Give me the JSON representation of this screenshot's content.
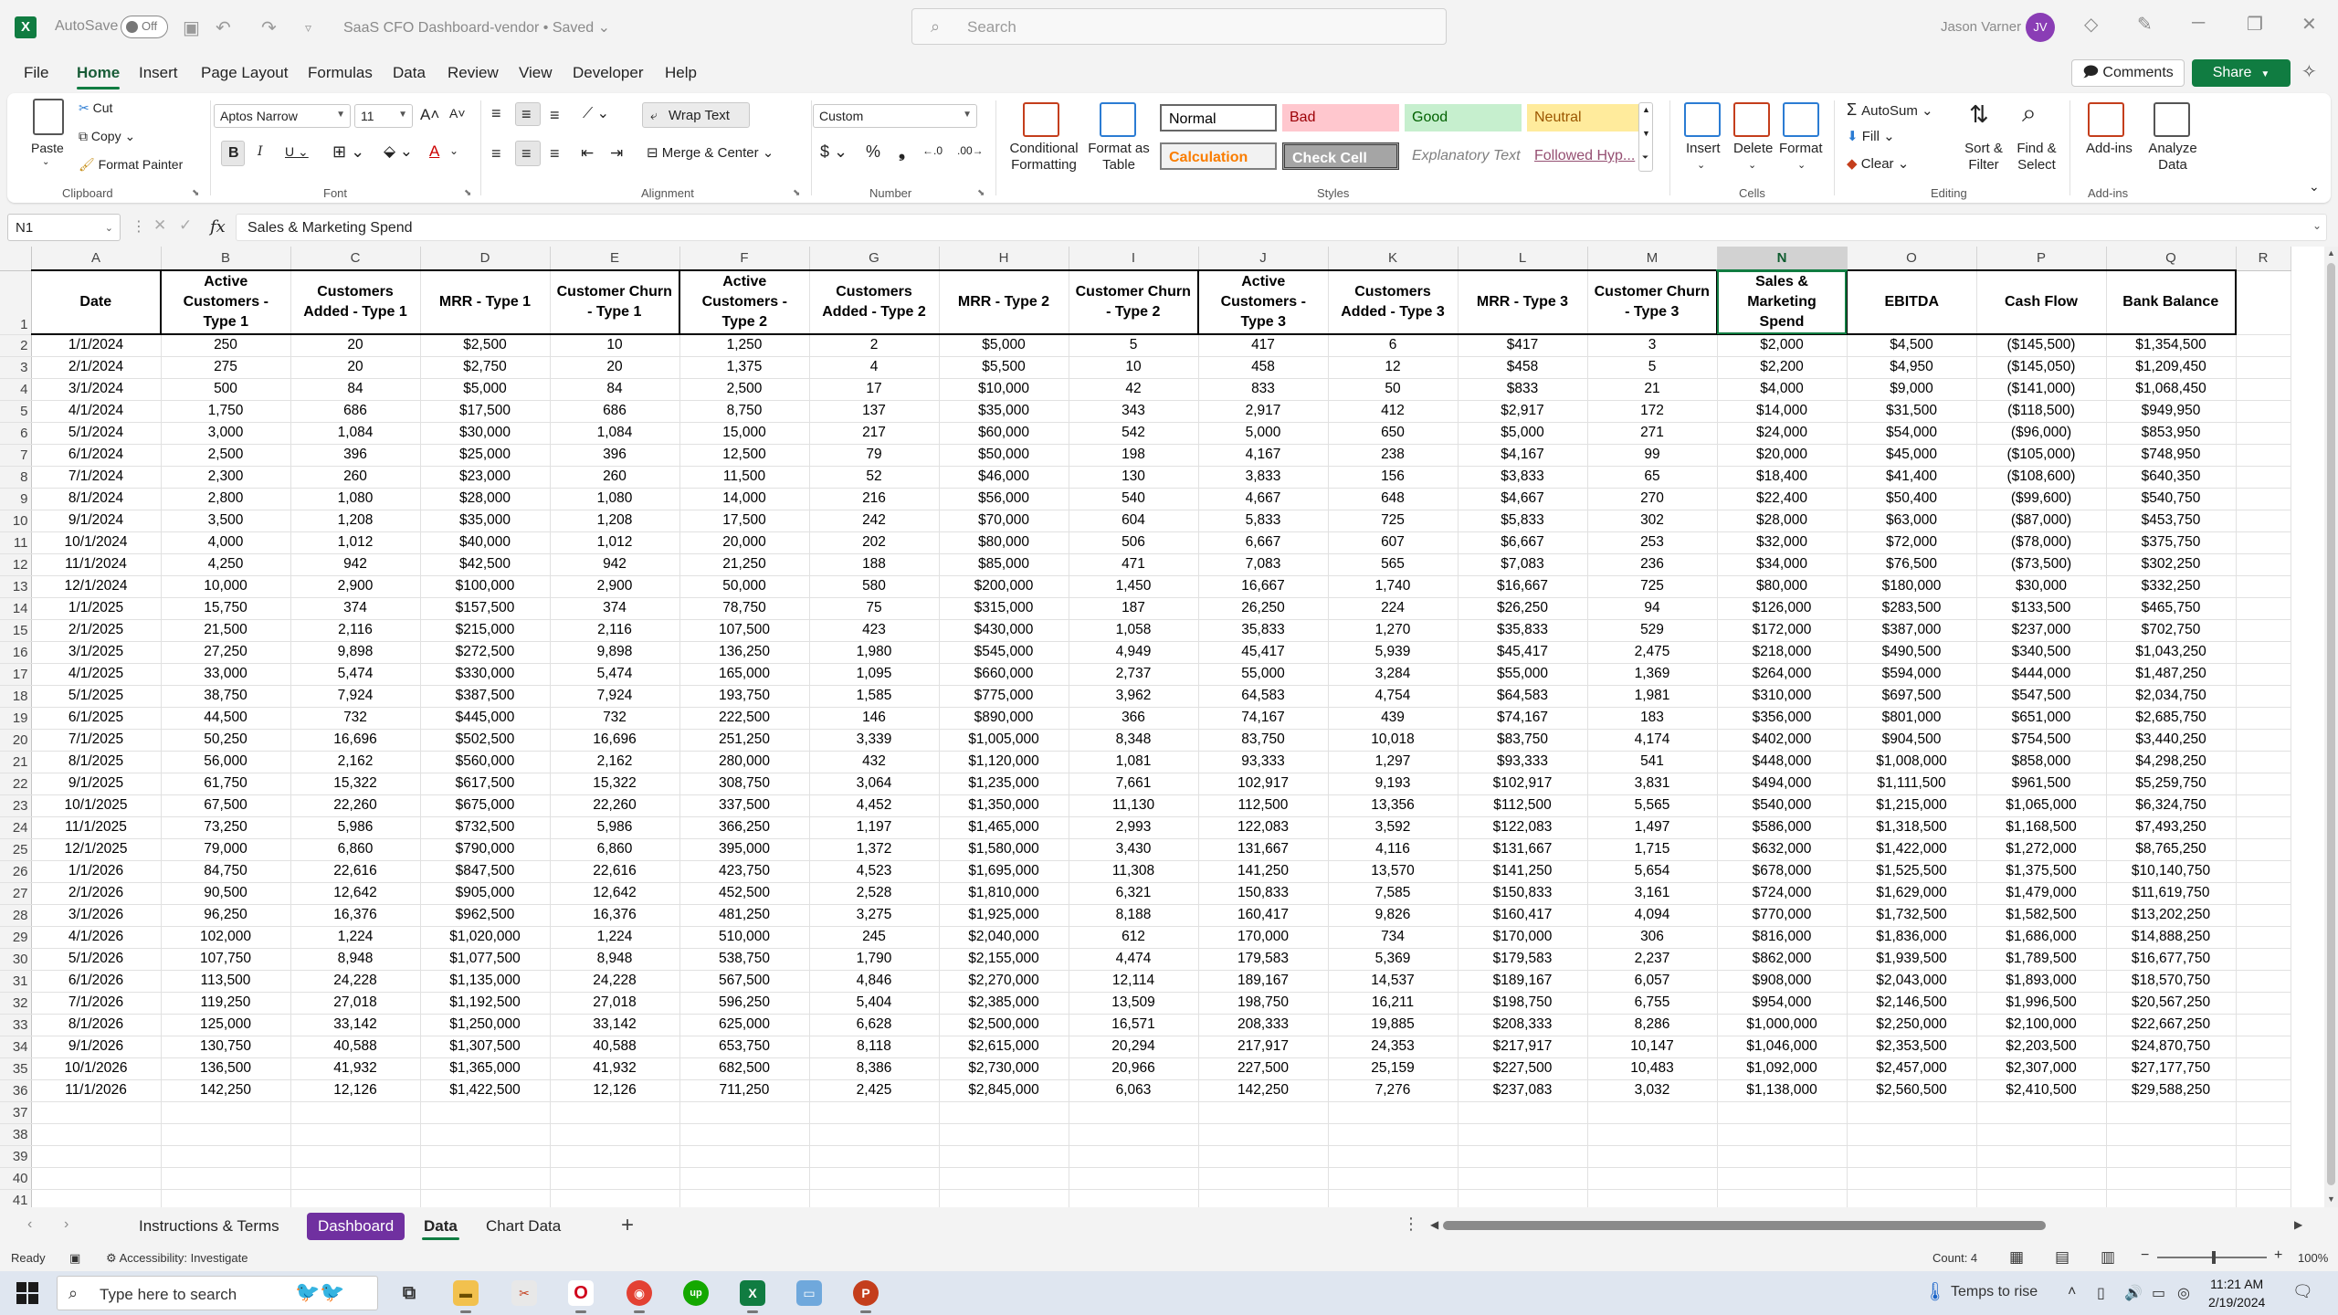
{
  "titlebar": {
    "autosave_label": "AutoSave",
    "autosave_state": "Off",
    "doc_title": "SaaS CFO Dashboard-vendor • Saved ⌄",
    "search_placeholder": "Search",
    "user_name": "Jason Varner",
    "user_initials": "JV"
  },
  "menu": {
    "tabs": [
      "File",
      "Home",
      "Insert",
      "Page Layout",
      "Formulas",
      "Data",
      "Review",
      "View",
      "Developer",
      "Help"
    ],
    "active": "Home",
    "comments_label": "Comments",
    "share_label": "Share"
  },
  "ribbon": {
    "clipboard": {
      "paste": "Paste",
      "cut": "Cut",
      "copy": "Copy",
      "format_painter": "Format Painter",
      "label": "Clipboard"
    },
    "font": {
      "name": "Aptos Narrow",
      "size": "11",
      "label": "Font"
    },
    "alignment": {
      "wrap_text": "Wrap Text",
      "merge_center": "Merge & Center",
      "label": "Alignment"
    },
    "number": {
      "format": "Custom",
      "label": "Number"
    },
    "styles": {
      "conditional_formatting": "Conditional Formatting",
      "format_as_table": "Format as Table",
      "label": "Styles",
      "cells": [
        {
          "label": "Normal",
          "bg": "#ffffff",
          "fg": "#000000"
        },
        {
          "label": "Bad",
          "bg": "#ffc7ce",
          "fg": "#9c0006"
        },
        {
          "label": "Good",
          "bg": "#c6efce",
          "fg": "#006100"
        },
        {
          "label": "Neutral",
          "bg": "#ffeb9c",
          "fg": "#9c5700"
        },
        {
          "label": "Calculation",
          "bg": "#f2f2f2",
          "fg": "#fa7d00"
        },
        {
          "label": "Check Cell",
          "bg": "#a5a5a5",
          "fg": "#ffffff"
        },
        {
          "label": "Explanatory Text",
          "bg": "#ffffff",
          "fg": "#7f7f7f"
        },
        {
          "label": "Followed Hyp...",
          "bg": "#ffffff",
          "fg": "#954f72"
        }
      ]
    },
    "cells": {
      "insert": "Insert",
      "delete": "Delete",
      "format": "Format",
      "label": "Cells"
    },
    "editing": {
      "autosum": "AutoSum",
      "fill": "Fill",
      "clear": "Clear",
      "sort_filter": "Sort & Filter",
      "find_select": "Find & Select",
      "label": "Editing"
    },
    "addins": {
      "addins": "Add-ins",
      "analyze": "Analyze Data",
      "label": "Add-ins"
    }
  },
  "formula_bar": {
    "name_box": "N1",
    "content": "Sales & Marketing Spend"
  },
  "sheet": {
    "columns": [
      "A",
      "B",
      "C",
      "D",
      "E",
      "F",
      "G",
      "H",
      "I",
      "J",
      "K",
      "L",
      "M",
      "N",
      "O",
      "P",
      "Q",
      "R"
    ],
    "selected_column": "N",
    "headers": [
      "Date",
      "Active Customers - Type 1",
      "Customers Added - Type 1",
      "MRR - Type 1",
      "Customer Churn - Type 1",
      "Active Customers - Type 2",
      "Customers Added - Type 2",
      "MRR - Type 2",
      "Customer Churn - Type 2",
      "Active Customers - Type 3",
      "Customers Added - Type 3",
      "MRR - Type 3",
      "Customer Churn - Type 3",
      "Sales & Marketing Spend",
      "EBITDA",
      "Cash Flow",
      "Bank Balance"
    ],
    "rows": [
      [
        "1/1/2024",
        "250",
        "20",
        "$2,500",
        "10",
        "1,250",
        "2",
        "$5,000",
        "5",
        "417",
        "6",
        "$417",
        "3",
        "$2,000",
        "$4,500",
        "($145,500)",
        "$1,354,500"
      ],
      [
        "2/1/2024",
        "275",
        "20",
        "$2,750",
        "20",
        "1,375",
        "4",
        "$5,500",
        "10",
        "458",
        "12",
        "$458",
        "5",
        "$2,200",
        "$4,950",
        "($145,050)",
        "$1,209,450"
      ],
      [
        "3/1/2024",
        "500",
        "84",
        "$5,000",
        "84",
        "2,500",
        "17",
        "$10,000",
        "42",
        "833",
        "50",
        "$833",
        "21",
        "$4,000",
        "$9,000",
        "($141,000)",
        "$1,068,450"
      ],
      [
        "4/1/2024",
        "1,750",
        "686",
        "$17,500",
        "686",
        "8,750",
        "137",
        "$35,000",
        "343",
        "2,917",
        "412",
        "$2,917",
        "172",
        "$14,000",
        "$31,500",
        "($118,500)",
        "$949,950"
      ],
      [
        "5/1/2024",
        "3,000",
        "1,084",
        "$30,000",
        "1,084",
        "15,000",
        "217",
        "$60,000",
        "542",
        "5,000",
        "650",
        "$5,000",
        "271",
        "$24,000",
        "$54,000",
        "($96,000)",
        "$853,950"
      ],
      [
        "6/1/2024",
        "2,500",
        "396",
        "$25,000",
        "396",
        "12,500",
        "79",
        "$50,000",
        "198",
        "4,167",
        "238",
        "$4,167",
        "99",
        "$20,000",
        "$45,000",
        "($105,000)",
        "$748,950"
      ],
      [
        "7/1/2024",
        "2,300",
        "260",
        "$23,000",
        "260",
        "11,500",
        "52",
        "$46,000",
        "130",
        "3,833",
        "156",
        "$3,833",
        "65",
        "$18,400",
        "$41,400",
        "($108,600)",
        "$640,350"
      ],
      [
        "8/1/2024",
        "2,800",
        "1,080",
        "$28,000",
        "1,080",
        "14,000",
        "216",
        "$56,000",
        "540",
        "4,667",
        "648",
        "$4,667",
        "270",
        "$22,400",
        "$50,400",
        "($99,600)",
        "$540,750"
      ],
      [
        "9/1/2024",
        "3,500",
        "1,208",
        "$35,000",
        "1,208",
        "17,500",
        "242",
        "$70,000",
        "604",
        "5,833",
        "725",
        "$5,833",
        "302",
        "$28,000",
        "$63,000",
        "($87,000)",
        "$453,750"
      ],
      [
        "10/1/2024",
        "4,000",
        "1,012",
        "$40,000",
        "1,012",
        "20,000",
        "202",
        "$80,000",
        "506",
        "6,667",
        "607",
        "$6,667",
        "253",
        "$32,000",
        "$72,000",
        "($78,000)",
        "$375,750"
      ],
      [
        "11/1/2024",
        "4,250",
        "942",
        "$42,500",
        "942",
        "21,250",
        "188",
        "$85,000",
        "471",
        "7,083",
        "565",
        "$7,083",
        "236",
        "$34,000",
        "$76,500",
        "($73,500)",
        "$302,250"
      ],
      [
        "12/1/2024",
        "10,000",
        "2,900",
        "$100,000",
        "2,900",
        "50,000",
        "580",
        "$200,000",
        "1,450",
        "16,667",
        "1,740",
        "$16,667",
        "725",
        "$80,000",
        "$180,000",
        "$30,000",
        "$332,250"
      ],
      [
        "1/1/2025",
        "15,750",
        "374",
        "$157,500",
        "374",
        "78,750",
        "75",
        "$315,000",
        "187",
        "26,250",
        "224",
        "$26,250",
        "94",
        "$126,000",
        "$283,500",
        "$133,500",
        "$465,750"
      ],
      [
        "2/1/2025",
        "21,500",
        "2,116",
        "$215,000",
        "2,116",
        "107,500",
        "423",
        "$430,000",
        "1,058",
        "35,833",
        "1,270",
        "$35,833",
        "529",
        "$172,000",
        "$387,000",
        "$237,000",
        "$702,750"
      ],
      [
        "3/1/2025",
        "27,250",
        "9,898",
        "$272,500",
        "9,898",
        "136,250",
        "1,980",
        "$545,000",
        "4,949",
        "45,417",
        "5,939",
        "$45,417",
        "2,475",
        "$218,000",
        "$490,500",
        "$340,500",
        "$1,043,250"
      ],
      [
        "4/1/2025",
        "33,000",
        "5,474",
        "$330,000",
        "5,474",
        "165,000",
        "1,095",
        "$660,000",
        "2,737",
        "55,000",
        "3,284",
        "$55,000",
        "1,369",
        "$264,000",
        "$594,000",
        "$444,000",
        "$1,487,250"
      ],
      [
        "5/1/2025",
        "38,750",
        "7,924",
        "$387,500",
        "7,924",
        "193,750",
        "1,585",
        "$775,000",
        "3,962",
        "64,583",
        "4,754",
        "$64,583",
        "1,981",
        "$310,000",
        "$697,500",
        "$547,500",
        "$2,034,750"
      ],
      [
        "6/1/2025",
        "44,500",
        "732",
        "$445,000",
        "732",
        "222,500",
        "146",
        "$890,000",
        "366",
        "74,167",
        "439",
        "$74,167",
        "183",
        "$356,000",
        "$801,000",
        "$651,000",
        "$2,685,750"
      ],
      [
        "7/1/2025",
        "50,250",
        "16,696",
        "$502,500",
        "16,696",
        "251,250",
        "3,339",
        "$1,005,000",
        "8,348",
        "83,750",
        "10,018",
        "$83,750",
        "4,174",
        "$402,000",
        "$904,500",
        "$754,500",
        "$3,440,250"
      ],
      [
        "8/1/2025",
        "56,000",
        "2,162",
        "$560,000",
        "2,162",
        "280,000",
        "432",
        "$1,120,000",
        "1,081",
        "93,333",
        "1,297",
        "$93,333",
        "541",
        "$448,000",
        "$1,008,000",
        "$858,000",
        "$4,298,250"
      ],
      [
        "9/1/2025",
        "61,750",
        "15,322",
        "$617,500",
        "15,322",
        "308,750",
        "3,064",
        "$1,235,000",
        "7,661",
        "102,917",
        "9,193",
        "$102,917",
        "3,831",
        "$494,000",
        "$1,111,500",
        "$961,500",
        "$5,259,750"
      ],
      [
        "10/1/2025",
        "67,500",
        "22,260",
        "$675,000",
        "22,260",
        "337,500",
        "4,452",
        "$1,350,000",
        "11,130",
        "112,500",
        "13,356",
        "$112,500",
        "5,565",
        "$540,000",
        "$1,215,000",
        "$1,065,000",
        "$6,324,750"
      ],
      [
        "11/1/2025",
        "73,250",
        "5,986",
        "$732,500",
        "5,986",
        "366,250",
        "1,197",
        "$1,465,000",
        "2,993",
        "122,083",
        "3,592",
        "$122,083",
        "1,497",
        "$586,000",
        "$1,318,500",
        "$1,168,500",
        "$7,493,250"
      ],
      [
        "12/1/2025",
        "79,000",
        "6,860",
        "$790,000",
        "6,860",
        "395,000",
        "1,372",
        "$1,580,000",
        "3,430",
        "131,667",
        "4,116",
        "$131,667",
        "1,715",
        "$632,000",
        "$1,422,000",
        "$1,272,000",
        "$8,765,250"
      ],
      [
        "1/1/2026",
        "84,750",
        "22,616",
        "$847,500",
        "22,616",
        "423,750",
        "4,523",
        "$1,695,000",
        "11,308",
        "141,250",
        "13,570",
        "$141,250",
        "5,654",
        "$678,000",
        "$1,525,500",
        "$1,375,500",
        "$10,140,750"
      ],
      [
        "2/1/2026",
        "90,500",
        "12,642",
        "$905,000",
        "12,642",
        "452,500",
        "2,528",
        "$1,810,000",
        "6,321",
        "150,833",
        "7,585",
        "$150,833",
        "3,161",
        "$724,000",
        "$1,629,000",
        "$1,479,000",
        "$11,619,750"
      ],
      [
        "3/1/2026",
        "96,250",
        "16,376",
        "$962,500",
        "16,376",
        "481,250",
        "3,275",
        "$1,925,000",
        "8,188",
        "160,417",
        "9,826",
        "$160,417",
        "4,094",
        "$770,000",
        "$1,732,500",
        "$1,582,500",
        "$13,202,250"
      ],
      [
        "4/1/2026",
        "102,000",
        "1,224",
        "$1,020,000",
        "1,224",
        "510,000",
        "245",
        "$2,040,000",
        "612",
        "170,000",
        "734",
        "$170,000",
        "306",
        "$816,000",
        "$1,836,000",
        "$1,686,000",
        "$14,888,250"
      ],
      [
        "5/1/2026",
        "107,750",
        "8,948",
        "$1,077,500",
        "8,948",
        "538,750",
        "1,790",
        "$2,155,000",
        "4,474",
        "179,583",
        "5,369",
        "$179,583",
        "2,237",
        "$862,000",
        "$1,939,500",
        "$1,789,500",
        "$16,677,750"
      ],
      [
        "6/1/2026",
        "113,500",
        "24,228",
        "$1,135,000",
        "24,228",
        "567,500",
        "4,846",
        "$2,270,000",
        "12,114",
        "189,167",
        "14,537",
        "$189,167",
        "6,057",
        "$908,000",
        "$2,043,000",
        "$1,893,000",
        "$18,570,750"
      ],
      [
        "7/1/2026",
        "119,250",
        "27,018",
        "$1,192,500",
        "27,018",
        "596,250",
        "5,404",
        "$2,385,000",
        "13,509",
        "198,750",
        "16,211",
        "$198,750",
        "6,755",
        "$954,000",
        "$2,146,500",
        "$1,996,500",
        "$20,567,250"
      ],
      [
        "8/1/2026",
        "125,000",
        "33,142",
        "$1,250,000",
        "33,142",
        "625,000",
        "6,628",
        "$2,500,000",
        "16,571",
        "208,333",
        "19,885",
        "$208,333",
        "8,286",
        "$1,000,000",
        "$2,250,000",
        "$2,100,000",
        "$22,667,250"
      ],
      [
        "9/1/2026",
        "130,750",
        "40,588",
        "$1,307,500",
        "40,588",
        "653,750",
        "8,118",
        "$2,615,000",
        "20,294",
        "217,917",
        "24,353",
        "$217,917",
        "10,147",
        "$1,046,000",
        "$2,353,500",
        "$2,203,500",
        "$24,870,750"
      ],
      [
        "10/1/2026",
        "136,500",
        "41,932",
        "$1,365,000",
        "41,932",
        "682,500",
        "8,386",
        "$2,730,000",
        "20,966",
        "227,500",
        "25,159",
        "$227,500",
        "10,483",
        "$1,092,000",
        "$2,457,000",
        "$2,307,000",
        "$27,177,750"
      ],
      [
        "11/1/2026",
        "142,250",
        "12,126",
        "$1,422,500",
        "12,126",
        "711,250",
        "2,425",
        "$2,845,000",
        "6,063",
        "142,250",
        "7,276",
        "$237,083",
        "3,032",
        "$1,138,000",
        "$2,560,500",
        "$2,410,500",
        "$29,588,250"
      ]
    ],
    "empty_row_numbers": [
      "37",
      "38",
      "39",
      "40",
      "41"
    ]
  },
  "sheet_tabs": {
    "tabs": [
      "Instructions & Terms",
      "Dashboard",
      "Data",
      "Chart Data"
    ],
    "active": "Data",
    "colored": "Dashboard",
    "colored_color": "#7030a0"
  },
  "status_bar": {
    "ready": "Ready",
    "accessibility": "Accessibility: Investigate",
    "count": "Count: 4",
    "zoom": "100%"
  },
  "taskbar": {
    "search_placeholder": "Type here to search",
    "weather": "Temps to rise",
    "time": "11:21 AM",
    "date": "2/19/2024"
  }
}
